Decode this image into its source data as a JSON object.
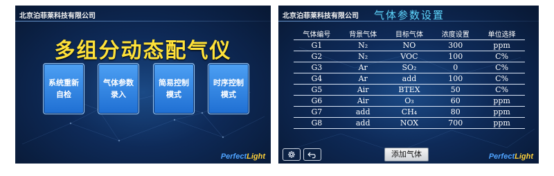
{
  "left_screen": {
    "company": "北京泊菲莱科技有限公司",
    "title": "多组分动态配气仪",
    "buttons": [
      {
        "line1": "系统重新",
        "line2": "自检"
      },
      {
        "line1": "气体参数",
        "line2": "录入"
      },
      {
        "line1": "简易控制",
        "line2": "模式"
      },
      {
        "line1": "时序控制",
        "line2": "模式"
      }
    ],
    "logo": {
      "part1": "Perfect",
      "part2": "Light"
    }
  },
  "right_screen": {
    "company": "北京泊菲莱科技有限公司",
    "title": "气体参数设置",
    "table": {
      "headers": [
        "气体编号",
        "背景气体",
        "目标气体",
        "浓度设置",
        "单位选择"
      ],
      "rows": [
        [
          "G1",
          "N₂",
          "NO",
          "300",
          "ppm"
        ],
        [
          "G2",
          "N₂",
          "VOC",
          "100",
          "C%"
        ],
        [
          "G3",
          "Ar",
          "SO₂",
          "0",
          "C%"
        ],
        [
          "G4",
          "Ar",
          "add",
          "100",
          "C%"
        ],
        [
          "G5",
          "Air",
          "BTEX",
          "50",
          "C%"
        ],
        [
          "G6",
          "Air",
          "O₃",
          "60",
          "ppm"
        ],
        [
          "G7",
          "add",
          "CH₄",
          "80",
          "ppm"
        ],
        [
          "G8",
          "add",
          "NOX",
          "700",
          "ppm"
        ]
      ]
    },
    "add_gas_label": "添加气体",
    "icons": {
      "settings": "gear-icon",
      "back": "back-arrow-icon"
    },
    "logo": {
      "part1": "Perfect",
      "part2": "Light"
    }
  },
  "colors": {
    "background_dark": "#0e2a58",
    "title_yellow": "#ffe23a",
    "title_cyan": "#5fd8ff",
    "button_blue": "#2f83e3"
  }
}
